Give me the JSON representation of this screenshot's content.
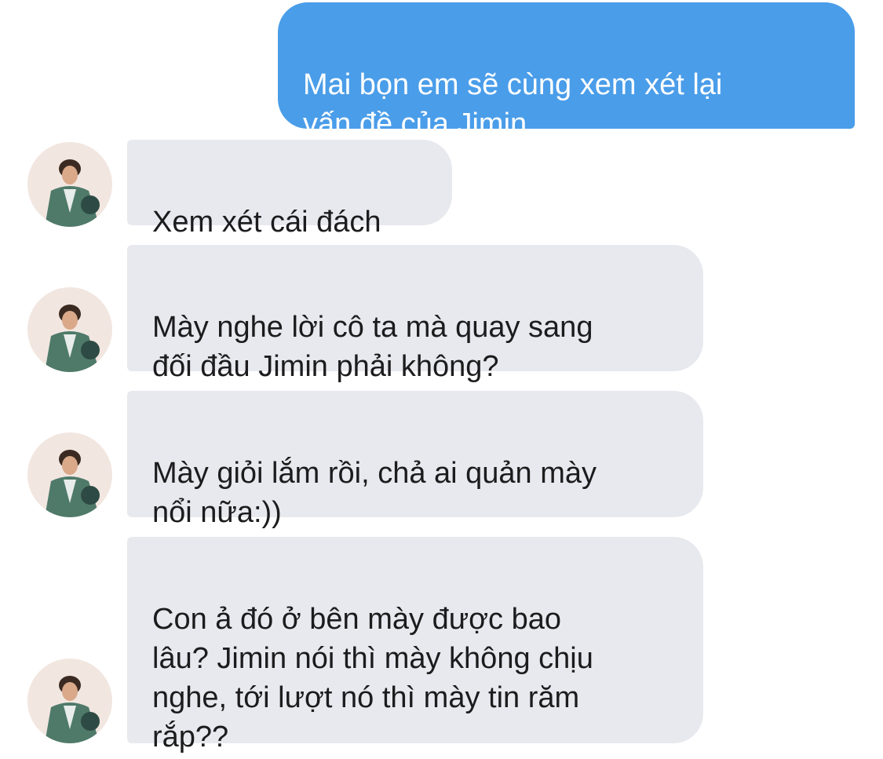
{
  "conversation": {
    "messages": [
      {
        "direction": "outgoing",
        "text": "Mai bọn em sẽ cùng xem xét lại\nvấn đề của Jimin"
      },
      {
        "direction": "incoming",
        "text": "Xem xét cái đách"
      },
      {
        "direction": "incoming",
        "text": "Mày nghe lời cô ta mà quay sang\nđối đầu Jimin phải không?"
      },
      {
        "direction": "incoming",
        "text": "Mày giỏi lắm rồi, chả ai quản mày\nnổi nữa:))"
      },
      {
        "direction": "incoming",
        "text": "Con ả đó ở bên mày được bao\nlâu? Jimin nói thì mày không chịu\nnghe, tới lượt nó thì mày tin răm\nrắp??"
      }
    ]
  },
  "colors": {
    "outgoing_bubble": "#4a9de9",
    "incoming_bubble": "#e8e9ee",
    "background": "#ffffff"
  }
}
